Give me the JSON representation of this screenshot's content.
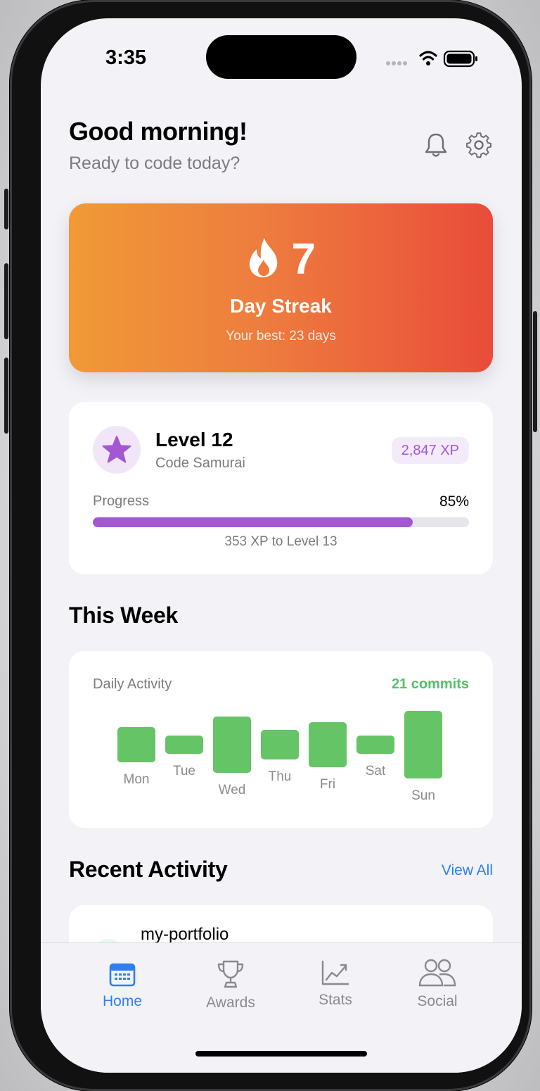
{
  "status_bar": {
    "time": "3:35"
  },
  "header": {
    "greeting": "Good morning!",
    "subtitle": "Ready to code today?",
    "bell_icon": "bell-icon",
    "settings_icon": "gear-icon"
  },
  "streak": {
    "icon": "flame-icon",
    "count": "7",
    "label": "Day Streak",
    "best": "Your best: 23 days",
    "colors": {
      "start": "#f09a36",
      "end": "#e94c3a"
    }
  },
  "level": {
    "icon": "star-icon",
    "title": "Level 12",
    "rank": "Code Samurai",
    "xp": "2,847 XP",
    "progress_label": "Progress",
    "progress_percent_text": "85%",
    "progress_value": 0.85,
    "next_level_note": "353 XP to Level 13",
    "accent": "#a457d3"
  },
  "this_week": {
    "heading": "This Week",
    "card_title": "Daily Activity",
    "commits_label": "21 commits",
    "bar_color": "#65c466",
    "days": [
      {
        "label": "Mon",
        "value": 3
      },
      {
        "label": "Tue",
        "value": 1.5
      },
      {
        "label": "Wed",
        "value": 5
      },
      {
        "label": "Thu",
        "value": 2.5
      },
      {
        "label": "Fri",
        "value": 4
      },
      {
        "label": "Sat",
        "value": 1.5
      },
      {
        "label": "Sun",
        "value": 6
      }
    ]
  },
  "recent_activity": {
    "heading": "Recent Activity",
    "view_all": "View All",
    "items": [
      {
        "name": "my-portfolio"
      }
    ]
  },
  "tab_bar": {
    "tabs": [
      {
        "label": "Home",
        "icon": "calendar-icon",
        "active": true
      },
      {
        "label": "Awards",
        "icon": "trophy-icon",
        "active": false
      },
      {
        "label": "Stats",
        "icon": "chart-line-icon",
        "active": false
      },
      {
        "label": "Social",
        "icon": "people-icon",
        "active": false
      }
    ],
    "active_color": "#2f7ff0"
  }
}
